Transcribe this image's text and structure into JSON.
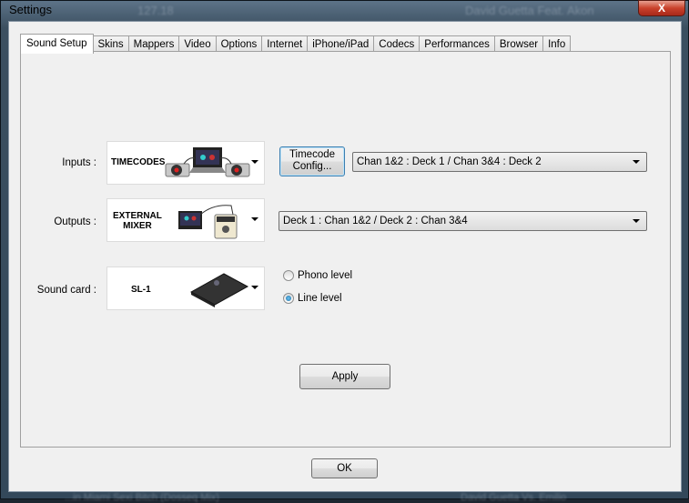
{
  "window": {
    "title": "Settings",
    "close_label": "X"
  },
  "background": {
    "top_text_1": "127.18",
    "top_text_2": "David Guetta Feat. Akon",
    "bottom_text_1": "...in Miami Sexi Bitch (Dosseq Mix)",
    "bottom_text_2": "David Guetta Vs. Emilio"
  },
  "tabs": [
    "Sound Setup",
    "Skins",
    "Mappers",
    "Video",
    "Options",
    "Internet",
    "iPhone/iPad",
    "Codecs",
    "Performances",
    "Browser",
    "Info"
  ],
  "sound_setup": {
    "inputs": {
      "label": "Inputs :",
      "device": "TIMECODES",
      "config_button_line1": "Timecode",
      "config_button_line2": "Config...",
      "routing": "Chan 1&2 : Deck 1 / Chan 3&4 : Deck 2"
    },
    "outputs": {
      "label": "Outputs :",
      "device_line1": "EXTERNAL",
      "device_line2": "MIXER",
      "routing": "Deck 1 : Chan 1&2 / Deck 2 : Chan 3&4"
    },
    "sound_card": {
      "label": "Sound card :",
      "device": "SL-1",
      "options": [
        {
          "label": "Phono level",
          "selected": false
        },
        {
          "label": "Line level",
          "selected": true
        }
      ]
    },
    "apply_label": "Apply"
  },
  "ok_label": "OK"
}
